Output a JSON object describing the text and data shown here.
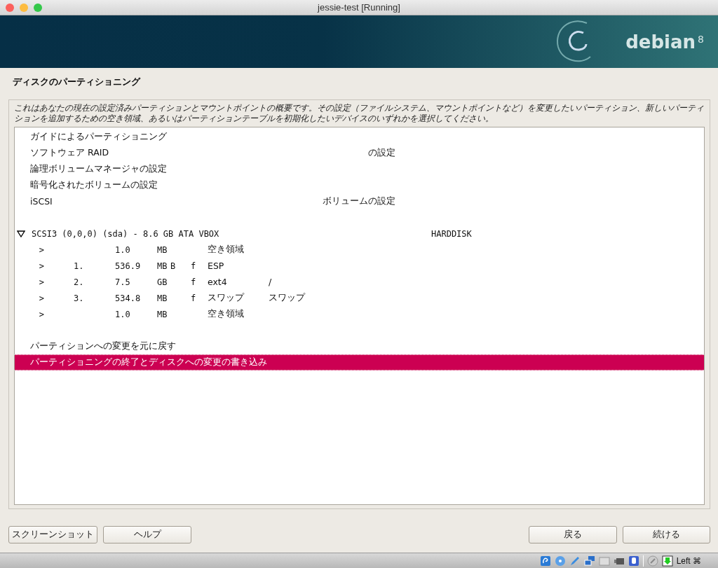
{
  "window": {
    "title": "jessie-test [Running]"
  },
  "banner": {
    "logo": "debian",
    "version": "8"
  },
  "heading": "ディスクのパーティショニング",
  "description": "これはあなたの現在の設定済みパーティションとマウントポイントの概要です。その設定（ファイルシステム、マウントポイントなど）を変更したいパーティション、新しいパーティションを追加するための空き領域、あるいはパーティションテーブルを初期化したいデバイスのいずれかを選択してください。",
  "rows": [
    {
      "kind": "item",
      "text": "ガイドによるパーティショニング",
      "selected": false
    },
    {
      "kind": "item",
      "text": "ソフトウェア RAID",
      "tail": "の設定",
      "selected": false
    },
    {
      "kind": "item",
      "text": "論理ボリュームマネージャの設定",
      "selected": false
    },
    {
      "kind": "item",
      "text": "暗号化されたボリュームの設定",
      "selected": false
    },
    {
      "kind": "item",
      "text": "iSCSI",
      "tail": "ボリュームの設定",
      "selected": false
    },
    {
      "kind": "blank"
    },
    {
      "kind": "disk",
      "text": "SCSI3 (0,0,0) (sda) - 8.6 GB ATA VBOX",
      "tail": "HARDDISK",
      "expanded": true,
      "selected": false
    },
    {
      "kind": "partition",
      "arrow": ">",
      "size": "1.0",
      "unit": "MB",
      "fs": "空き領域",
      "selected": false
    },
    {
      "kind": "partition",
      "arrow": ">",
      "number": "1.",
      "size": "536.9",
      "unit": "MB",
      "bootable": "B",
      "format": "f",
      "fs": "ESP",
      "selected": false
    },
    {
      "kind": "partition",
      "arrow": ">",
      "number": "2.",
      "size": "7.5",
      "unit": "GB",
      "format": "f",
      "fs": "ext4",
      "mount": "/",
      "selected": false
    },
    {
      "kind": "partition",
      "arrow": ">",
      "number": "3.",
      "size": "534.8",
      "unit": "MB",
      "format": "f",
      "fs": "スワップ",
      "mount": "スワップ",
      "selected": false
    },
    {
      "kind": "partition",
      "arrow": ">",
      "size": "1.0",
      "unit": "MB",
      "fs": "空き領域",
      "selected": false
    },
    {
      "kind": "blank"
    },
    {
      "kind": "item",
      "text": "パーティションへの変更を元に戻す",
      "selected": false
    },
    {
      "kind": "item",
      "text": "パーティショニングの終了とディスクへの変更の書き込み",
      "selected": true
    }
  ],
  "buttons_left": [
    "スクリーンショット",
    "ヘルプ"
  ],
  "buttons_right": [
    "戻る",
    "続ける"
  ],
  "status_bar": {
    "host_key": "Left ⌘"
  }
}
